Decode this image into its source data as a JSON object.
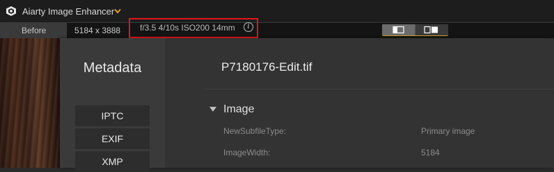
{
  "app": {
    "title": "Aiarty Image Enhancer"
  },
  "infobar": {
    "before_label": "Before",
    "dimensions": "5184 x 3888",
    "exif_summary": "f/3.5 4/10s ISO200 14mm",
    "info_icon": "info-icon"
  },
  "view_toggle": {
    "active": "single-view",
    "accent_color": "#d3a01f"
  },
  "metadata": {
    "heading": "Metadata",
    "tabs": [
      {
        "label": "IPTC"
      },
      {
        "label": "EXIF"
      },
      {
        "label": "XMP"
      }
    ],
    "filename": "P7180176-Edit.tif",
    "section": {
      "title": "Image",
      "expanded": true
    },
    "rows": [
      {
        "key": "NewSubfileType:",
        "value": "Primary image"
      },
      {
        "key": "ImageWidth:",
        "value": "5184"
      }
    ]
  },
  "colors": {
    "highlight_box": "#e3141b",
    "panel_bg": "#383838"
  }
}
